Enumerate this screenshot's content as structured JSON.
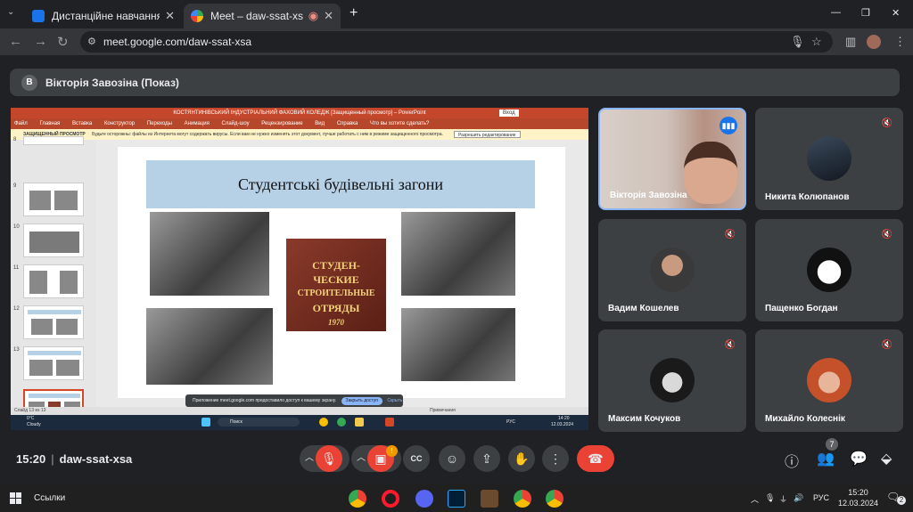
{
  "browser": {
    "tabs": [
      {
        "title": "Дистанційне навчання в ВСП",
        "active": false
      },
      {
        "title": "Meet – daw-ssat-xsa",
        "active": true
      }
    ],
    "new_tab": "+",
    "url": "meet.google.com/daw-ssat-xsa",
    "window_controls": [
      "—",
      "❐",
      "✕"
    ]
  },
  "presenter_bar": {
    "avatar_letter": "В",
    "label": "Вікторія Завозіна (Показ)"
  },
  "shared_screen": {
    "app_title": "КОСТЯНТИНІВСЬКИЙ ІНДУСТРІАЛЬНИЙ ФАХОВИЙ КОЛЕДЖ [Защищенный просмотр] – PowerPoint",
    "login_label": "Вход",
    "ribbon_tabs": [
      "Файл",
      "Главная",
      "Вставка",
      "Конструктор",
      "Переходы",
      "Анимация",
      "Слайд-шоу",
      "Рецензирование",
      "Вид",
      "Справка",
      "Что вы хотите сделать?"
    ],
    "protected_label": "ЗАЩИЩЕННЫЙ ПРОСМОТР",
    "protected_text": "Будьте осторожны: файлы из Интернета могут содержать вирусы. Если вам не нужно изменять этот документ, лучше работать с ним в режиме защищенного просмотра.",
    "enable_editing": "Разрешить редактирование",
    "thumb_numbers": [
      "8",
      "9",
      "10",
      "11",
      "12",
      "13"
    ],
    "slide_title": "Студентські будівельні загони",
    "badge_text": [
      "СТУДЕН-",
      "ЧЕСКИЕ",
      "СТРОИТЕЛЬНЫЕ",
      "ОТРЯДЫ",
      "1970"
    ],
    "status_left": "Слайд 13 из 13",
    "status_right": "Примечания",
    "share_notice": "Приложение meet.google.com предоставило доступ к вашему экрану.",
    "stop_sharing": "Закрыть доступ",
    "hide": "Скрыть",
    "weather_temp": "0°C",
    "weather_text": "Cloudy",
    "search_label": "Поиск",
    "inner_lang": "РУС",
    "inner_time": "14:20",
    "inner_date": "12.03.2024"
  },
  "participants": [
    {
      "name": "Вікторія Завозіна",
      "speaking": true
    },
    {
      "name": "Никита Колюпанов",
      "muted": true
    },
    {
      "name": "Вадим Кошелев",
      "muted": true
    },
    {
      "name": "Пащенко Богдан",
      "muted": true
    },
    {
      "name": "Максим Кочуков",
      "muted": true
    },
    {
      "name": "Михайло Колеснік",
      "muted": true
    }
  ],
  "call": {
    "time": "15:20",
    "code": "daw-ssat-xsa",
    "camera_notification": "!",
    "people_count": "7"
  },
  "taskbar": {
    "search_label": "Ссылки",
    "language": "РУС",
    "time": "15:20",
    "date": "12.03.2024",
    "notification_count": "2"
  },
  "colors": {
    "meet_bg": "#202124",
    "tile_bg": "#3c4043",
    "end_call": "#ea4335",
    "accent": "#8ab4f8",
    "ppt_brand": "#b7472a"
  }
}
